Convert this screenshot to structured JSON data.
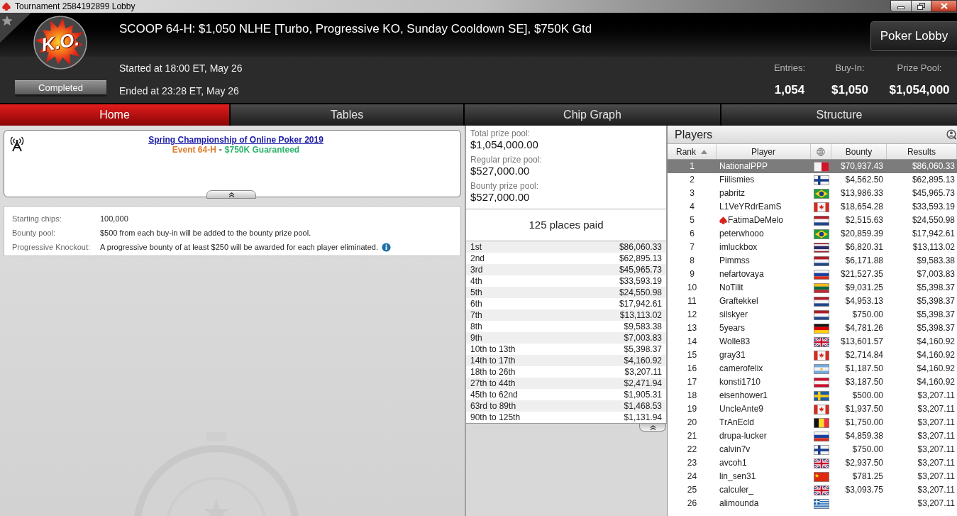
{
  "window": {
    "title": "Tournament 2584192899 Lobby"
  },
  "header": {
    "logo_text": "K.O.",
    "title": "SCOOP 64-H: $1,050 NLHE [Turbo, Progressive KO, Sunday Cooldown SE], $750K Gtd",
    "status": "Completed",
    "started": "Started at 18:00 ET, May 26",
    "ended": "Ended at 23:28 ET, May 26",
    "lobby_button": "Poker Lobby",
    "stats": [
      {
        "label": "Entries:",
        "value": "1,054"
      },
      {
        "label": "Buy-In:",
        "value": "$1,050"
      },
      {
        "label": "Prize Pool:",
        "value": "$1,054,000"
      }
    ]
  },
  "tabs": [
    {
      "label": "Home",
      "selected": true
    },
    {
      "label": "Tables",
      "selected": false
    },
    {
      "label": "Chip Graph",
      "selected": false
    },
    {
      "label": "Structure",
      "selected": false
    }
  ],
  "banner": {
    "link": "Spring Championship of Online Poker 2019",
    "event": "Event 64-H",
    "separator": "-",
    "guarantee": "$750K Guaranteed"
  },
  "details": [
    {
      "label": "Starting chips:",
      "value": "100,000",
      "info": false
    },
    {
      "label": "Bounty pool:",
      "value": "$500 from each buy-in will be added to the bounty prize pool.",
      "info": false
    },
    {
      "label": "Progressive Knockout:",
      "value": "A progressive bounty of at least $250 will be awarded for each player eliminated.",
      "info": true
    }
  ],
  "prize_pools": [
    {
      "label": "Total prize pool:",
      "value": "$1,054,000.00"
    },
    {
      "label": "Regular prize pool:",
      "value": "$527,000.00"
    },
    {
      "label": "Bounty prize pool:",
      "value": "$527,000.00"
    }
  ],
  "places_paid": "125 places paid",
  "payouts": [
    {
      "place": "1st",
      "amount": "$86,060.33"
    },
    {
      "place": "2nd",
      "amount": "$62,895.13"
    },
    {
      "place": "3rd",
      "amount": "$45,965.73"
    },
    {
      "place": "4th",
      "amount": "$33,593.19"
    },
    {
      "place": "5th",
      "amount": "$24,550.98"
    },
    {
      "place": "6th",
      "amount": "$17,942.61"
    },
    {
      "place": "7th",
      "amount": "$13,113.02"
    },
    {
      "place": "8th",
      "amount": "$9,583.38"
    },
    {
      "place": "9th",
      "amount": "$7,003.83"
    },
    {
      "place": "10th to 13th",
      "amount": "$5,398.37"
    },
    {
      "place": "14th to 17th",
      "amount": "$4,160.92"
    },
    {
      "place": "18th to 26th",
      "amount": "$3,207.11"
    },
    {
      "place": "27th to 44th",
      "amount": "$2,471.94"
    },
    {
      "place": "45th to 62nd",
      "amount": "$1,905.31"
    },
    {
      "place": "63rd to 89th",
      "amount": "$1,468.53"
    },
    {
      "place": "90th to 125th",
      "amount": "$1,131.94"
    }
  ],
  "players": {
    "title": "Players",
    "columns": [
      {
        "kind": "text",
        "label": "Rank",
        "sorted": true
      },
      {
        "kind": "text",
        "label": "Player",
        "sorted": false
      },
      {
        "kind": "icon",
        "sorted": false
      },
      {
        "kind": "text",
        "label": "Bounty",
        "sorted": false
      },
      {
        "kind": "text",
        "label": "Results",
        "sorted": false
      }
    ],
    "rows": [
      {
        "rank": "1",
        "name": "NationalPPP",
        "pro": false,
        "flag": {
          "kind": "malta"
        },
        "bounty": "$70,937.43",
        "result": "$86,060.33",
        "selected": true
      },
      {
        "rank": "2",
        "name": "Fiilismies",
        "pro": false,
        "flag": {
          "kind": "finland"
        },
        "bounty": "$4,562.50",
        "result": "$62,895.13",
        "selected": false
      },
      {
        "rank": "3",
        "name": "pabritz",
        "pro": false,
        "flag": {
          "kind": "brazil"
        },
        "bounty": "$13,986.33",
        "result": "$45,965.73",
        "selected": false
      },
      {
        "rank": "4",
        "name": "L1VeYRdrEamS",
        "pro": false,
        "flag": {
          "kind": "canada"
        },
        "bounty": "$18,654.28",
        "result": "$33,593.19",
        "selected": false
      },
      {
        "rank": "5",
        "name": "FatimaDeMelo",
        "pro": true,
        "flag": {
          "kind": "netherlands"
        },
        "bounty": "$2,515.63",
        "result": "$24,550.98",
        "selected": false
      },
      {
        "rank": "6",
        "name": "peterwhooo",
        "pro": false,
        "flag": {
          "kind": "brazil"
        },
        "bounty": "$20,859.39",
        "result": "$17,942.61",
        "selected": false
      },
      {
        "rank": "7",
        "name": "imluckbox",
        "pro": false,
        "flag": {
          "kind": "thailand"
        },
        "bounty": "$6,820.31",
        "result": "$13,113.02",
        "selected": false
      },
      {
        "rank": "8",
        "name": "Pimmss",
        "pro": false,
        "flag": {
          "kind": "netherlands"
        },
        "bounty": "$6,171.88",
        "result": "$9,583.38",
        "selected": false
      },
      {
        "rank": "9",
        "name": "nefartovaya",
        "pro": false,
        "flag": {
          "kind": "russia"
        },
        "bounty": "$21,527.35",
        "result": "$7,003.83",
        "selected": false
      },
      {
        "rank": "10",
        "name": "NoTilit",
        "pro": false,
        "flag": {
          "kind": "lithuania"
        },
        "bounty": "$9,031.25",
        "result": "$5,398.37",
        "selected": false
      },
      {
        "rank": "11",
        "name": "Graftekkel",
        "pro": false,
        "flag": {
          "kind": "netherlands"
        },
        "bounty": "$4,953.13",
        "result": "$5,398.37",
        "selected": false
      },
      {
        "rank": "12",
        "name": "silskyer",
        "pro": false,
        "flag": {
          "kind": "netherlands"
        },
        "bounty": "$750.00",
        "result": "$5,398.37",
        "selected": false
      },
      {
        "rank": "13",
        "name": "5years",
        "pro": false,
        "flag": {
          "kind": "germany"
        },
        "bounty": "$4,781.26",
        "result": "$5,398.37",
        "selected": false
      },
      {
        "rank": "14",
        "name": "Wolle83",
        "pro": false,
        "flag": {
          "kind": "uk"
        },
        "bounty": "$13,601.57",
        "result": "$4,160.92",
        "selected": false
      },
      {
        "rank": "15",
        "name": "gray31",
        "pro": false,
        "flag": {
          "kind": "canada"
        },
        "bounty": "$2,714.84",
        "result": "$4,160.92",
        "selected": false
      },
      {
        "rank": "16",
        "name": "camerofelix",
        "pro": false,
        "flag": {
          "kind": "argentina"
        },
        "bounty": "$1,187.50",
        "result": "$4,160.92",
        "selected": false
      },
      {
        "rank": "17",
        "name": "konsti1710",
        "pro": false,
        "flag": {
          "kind": "austria"
        },
        "bounty": "$3,187.50",
        "result": "$4,160.92",
        "selected": false
      },
      {
        "rank": "18",
        "name": "eisenhower1",
        "pro": false,
        "flag": {
          "kind": "sweden"
        },
        "bounty": "$500.00",
        "result": "$3,207.11",
        "selected": false
      },
      {
        "rank": "19",
        "name": "UncleAnte9",
        "pro": false,
        "flag": {
          "kind": "canada"
        },
        "bounty": "$1,937.50",
        "result": "$3,207.11",
        "selected": false
      },
      {
        "rank": "20",
        "name": "TrAnEcld",
        "pro": false,
        "flag": {
          "kind": "belgium"
        },
        "bounty": "$1,750.00",
        "result": "$3,207.11",
        "selected": false
      },
      {
        "rank": "21",
        "name": "drupa-lucker",
        "pro": false,
        "flag": {
          "kind": "russia"
        },
        "bounty": "$4,859.38",
        "result": "$3,207.11",
        "selected": false
      },
      {
        "rank": "22",
        "name": "calvin7v",
        "pro": false,
        "flag": {
          "kind": "finland"
        },
        "bounty": "$750.00",
        "result": "$3,207.11",
        "selected": false
      },
      {
        "rank": "23",
        "name": "avcoh1",
        "pro": false,
        "flag": {
          "kind": "uk"
        },
        "bounty": "$2,937.50",
        "result": "$3,207.11",
        "selected": false
      },
      {
        "rank": "24",
        "name": "lin_sen31",
        "pro": false,
        "flag": {
          "kind": "china"
        },
        "bounty": "$781.25",
        "result": "$3,207.11",
        "selected": false
      },
      {
        "rank": "25",
        "name": "calculer_",
        "pro": false,
        "flag": {
          "kind": "uk"
        },
        "bounty": "$3,093.75",
        "result": "$3,207.11",
        "selected": false
      },
      {
        "rank": "26",
        "name": "alimounda",
        "pro": false,
        "flag": {
          "kind": "greece"
        },
        "result": "$3,207.11",
        "selected": false
      }
    ]
  }
}
